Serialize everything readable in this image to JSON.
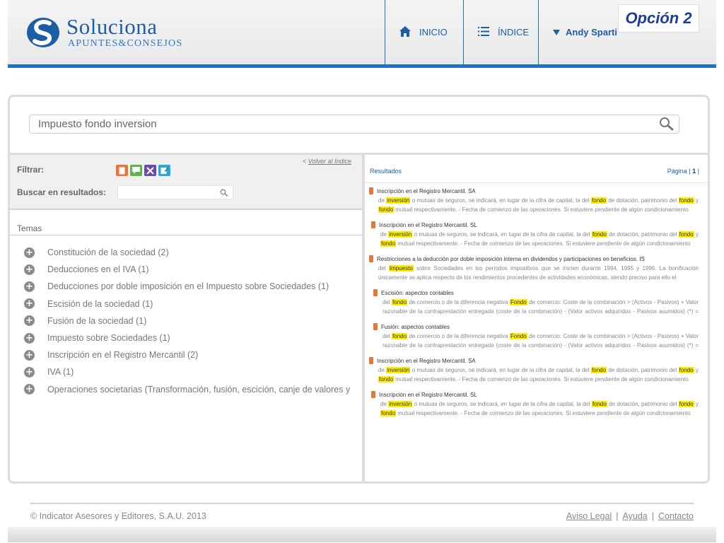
{
  "brand": {
    "title": "Soluciona",
    "subtitle": "APUNTES&CONSEJOS",
    "colors": {
      "primary": "#1c5ea6",
      "accent": "#1f73c2"
    }
  },
  "nav": {
    "home_label": "INICIO",
    "index_label": "ÍNDICE",
    "user_label": "Andy Sparti"
  },
  "option_badge": "Opción 2",
  "search": {
    "value": "Impuesto fondo inversion"
  },
  "filters": {
    "back_link_prefix": "< ",
    "back_link": "Volver al Índice",
    "filter_label": "Filtrar:",
    "search_in_results_label": "Buscar en resultados:",
    "filter_icons": [
      {
        "name": "document-filter-icon",
        "color": "#e8763a"
      },
      {
        "name": "comment-filter-icon",
        "color": "#5cb84a"
      },
      {
        "name": "tools-filter-icon",
        "color": "#6a4ba8"
      },
      {
        "name": "edit-filter-icon",
        "color": "#2aa6d9"
      }
    ]
  },
  "temas": {
    "heading": "Temas",
    "items": [
      "Constitución de la sociedad (2)",
      "Deducciones en el IVA (1)",
      "Deducciones por doble imposición en el Impuesto sobre Sociedades (1)",
      "Escisión de la sociedad (1)",
      "Fusión de la sociedad (1)",
      "Impuesto sobre Sociedades (1)",
      "Inscripción en el Registro Mercantil (2)",
      "IVA (1)",
      "Operaciones societarias (Transformación, fusión, escición, canje de valores y"
    ]
  },
  "results": {
    "label": "Resultados",
    "pager_label": "Página",
    "current_page": "1",
    "items": [
      {
        "title": "Inscripción en el Registro Mercantil. SA",
        "snippet": "de [inversión] o mutuas de seguros, se indicará, en lugar de la cifra de capital, la del [fondo] de dotación, patrimonio del [fondo] y [fondo] mutual respectivamente. - Fecha de comienzo de las operaciones. Si estuviere pendiente de algún condicionamiento"
      },
      {
        "title": "Inscripción en el Registro Mercantil. SL",
        "snippet": "de [inversión] o mutuas de seguros, se indicará, en lugar de la cifra de capital, la del [fondo] de dotación, patrimonio del [fondo] y [fondo] mutual respectivamente. - Fecha de comienzo de las operaciones. Si estuviere pendiente de algún condicionamiento"
      },
      {
        "title": "Restricciones a la deducción por doble imposición interna en dividendos y participaciones en beneficios. IS",
        "snippet": "del [Impuesto] sobre Sociedades en los períodos impositivos que se inicien durante 1994, 1995 y 1996. La bonificación únicamente se aplica respecto de los rendimientos procedentes de actividades económicas, siendo preciso para ello el"
      },
      {
        "title": "Escisión: aspectos contables",
        "snippet": "del [fondo] de comercio o de la diferencia negativa [Fondo] de comercio: Coste de la combinación > (Activos - Pasivos) + Valor razonable de la contraprestación entregada (coste de la combinación) - (Valor activos adquiridos - Pasivos asumidos) (*) = [Fondo]"
      },
      {
        "title": "Fusión: aspectos contables",
        "snippet": "del [fondo] de comercio o de la diferencia negativa [Fondo] de comercio: Coste de la combinación > (Activos - Pasivos) + Valor razonable de la contraprestación entregada (coste de la combinación) - (Valor activos adquiridos - Pasivos asumidos) (*) = [Fondo]"
      },
      {
        "title": "Inscripción en el Registro Mercantil. SA",
        "snippet": "de [inversión] o mutuas de seguros, se indicará, en lugar de la cifra de capital, la del [fondo] de dotación, patrimonio del [fondo] y [fondo] mutual respectivamente. - Fecha de comienzo de las operaciones. Si estuviere pendiente de algún condicionamiento"
      },
      {
        "title": "Inscripción en el Registro Mercantil. SL",
        "snippet": "de [inversión] o mutuas de seguros, se indicará, en lugar de la cifra de capital, la del [fondo] de dotación, patrimonio del [fondo] y [fondo] mutual respectivamente. - Fecha de comienzo de las operaciones. Si estuviere pendiente de algún condicionamiento"
      }
    ]
  },
  "footer": {
    "copyright": "© Indicator Asesores y Editores, S.A.U. 2013",
    "links": [
      "Aviso Legal",
      "Ayuda",
      "Contacto"
    ]
  }
}
